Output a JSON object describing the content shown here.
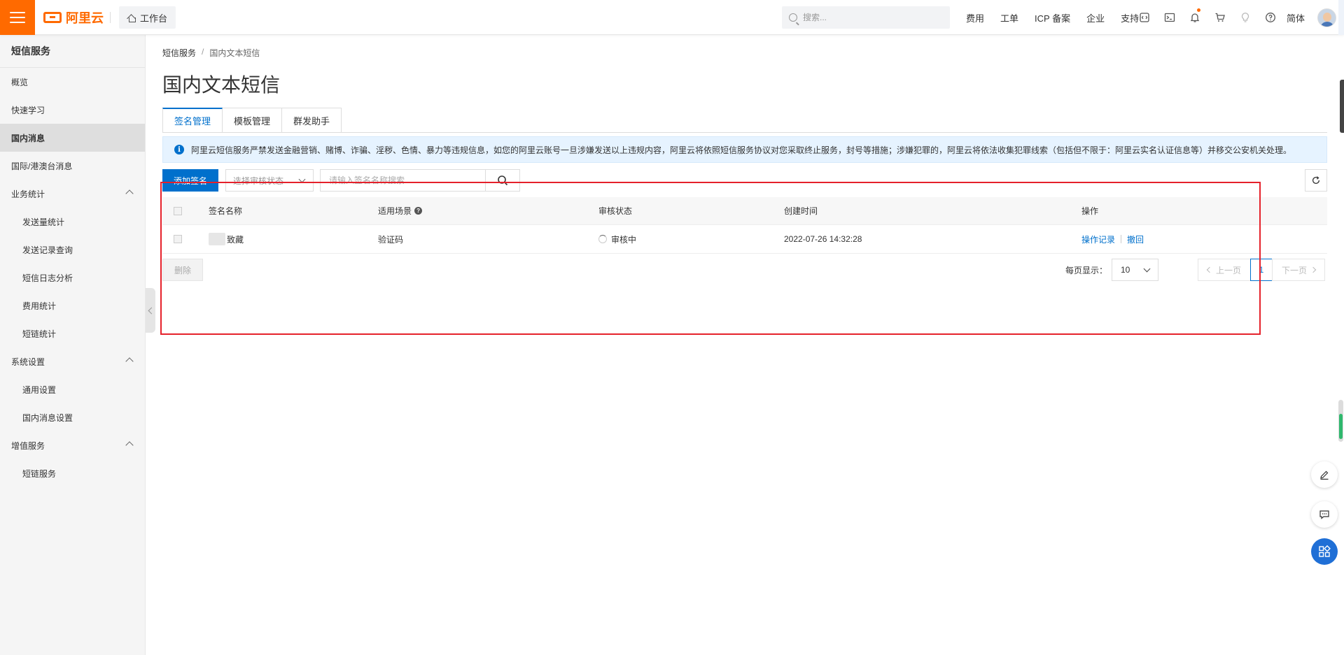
{
  "header": {
    "logo_text": "阿里云",
    "workbench_label": "工作台",
    "search_placeholder": "搜索...",
    "links": [
      "费用",
      "工单",
      "ICP 备案",
      "企业",
      "支持"
    ],
    "lang_label": "简体",
    "accent_color": "#ff6a00"
  },
  "sidebar": {
    "title": "短信服务",
    "items": [
      {
        "label": "概览"
      },
      {
        "label": "快速学习"
      },
      {
        "label": "国内消息"
      },
      {
        "label": "国际/港澳台消息"
      },
      {
        "label": "业务统计"
      },
      {
        "label": "发送量统计"
      },
      {
        "label": "发送记录查询"
      },
      {
        "label": "短信日志分析"
      },
      {
        "label": "费用统计"
      },
      {
        "label": "短链统计"
      },
      {
        "label": "系统设置"
      },
      {
        "label": "通用设置"
      },
      {
        "label": "国内消息设置"
      },
      {
        "label": "增值服务"
      },
      {
        "label": "短链服务"
      }
    ]
  },
  "breadcrumb": {
    "root": "短信服务",
    "separator": "/",
    "current": "国内文本短信"
  },
  "page_title": "国内文本短信",
  "tabs": [
    {
      "label": "签名管理"
    },
    {
      "label": "模板管理"
    },
    {
      "label": "群发助手"
    }
  ],
  "notice": "阿里云短信服务严禁发送金融营销、赌博、诈骗、淫秽、色情、暴力等违规信息，如您的阿里云账号一旦涉嫌发送以上违规内容，阿里云将依照短信服务协议对您采取终止服务，封号等措施；涉嫌犯罪的，阿里云将依法收集犯罪线索（包括但不限于：阿里云实名认证信息等）并移交公安机关处理。",
  "toolbar": {
    "add_label": "添加签名",
    "status_placeholder": "选择审核状态",
    "search_placeholder": "请输入签名名称搜索"
  },
  "table": {
    "columns": [
      "签名名称",
      "适用场景",
      "审核状态",
      "创建时间",
      "操作"
    ],
    "rows": [
      {
        "name": "致藏",
        "scene": "验证码",
        "status": "审核中",
        "created": "2022-07-26 14:32:28",
        "actions": [
          "操作记录",
          "撤回"
        ]
      }
    ]
  },
  "footer": {
    "delete_label": "删除",
    "page_size_label": "每页显示：",
    "page_size": "10",
    "prev_label": "上一页",
    "current_page": "1",
    "next_label": "下一页"
  },
  "colors": {
    "primary": "#0070cc",
    "annotation": "#e5212b",
    "notice_bg": "#e6f3ff"
  }
}
